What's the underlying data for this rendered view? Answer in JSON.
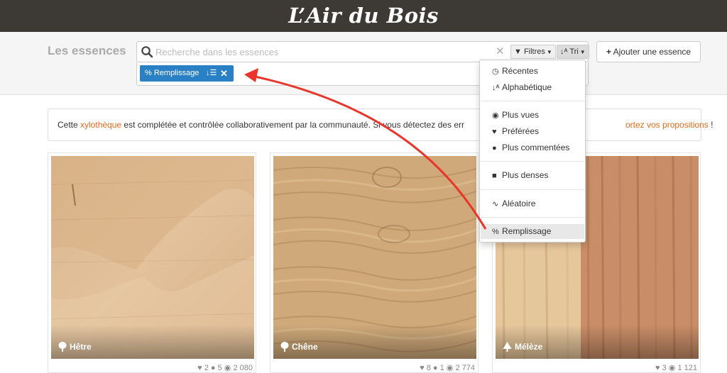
{
  "app": {
    "brand": "L’Air du Bois"
  },
  "toolbar": {
    "section_title": "Les essences",
    "search_placeholder": "Recherche dans les essences",
    "search_value": "",
    "filters_label": "Filtres",
    "sort_label": "Tri",
    "add_label": "Ajouter une essence"
  },
  "active_filter": {
    "label": "Remplissage",
    "sort_icon_text": "↓☰"
  },
  "info": {
    "before": "Cette ",
    "link": "xylothèque",
    "after": " est complétée et contrôlée collaborativement par la communauté. Si vous détectez des err",
    "right_link": "ortez vos propositions",
    "right_end": " !"
  },
  "sort_menu": {
    "items": [
      {
        "label": "Récentes",
        "icon": "clock-icon"
      },
      {
        "label": "Alphabétique",
        "icon": "alpha-sort-icon"
      },
      {
        "label": "Plus vues",
        "icon": "eye-icon"
      },
      {
        "label": "Préférées",
        "icon": "heart-icon"
      },
      {
        "label": "Plus commentées",
        "icon": "comment-icon"
      },
      {
        "label": "Plus denses",
        "icon": "weight-icon"
      },
      {
        "label": "Aléatoire",
        "icon": "random-icon"
      },
      {
        "label": "Remplissage",
        "icon": "percent-icon",
        "active": true
      }
    ]
  },
  "cards": [
    {
      "name": "Hêtre",
      "likes": "2",
      "comments": "5",
      "views": "2 080",
      "tree_icon": "deciduous-tree-icon"
    },
    {
      "name": "Chêne",
      "likes": "8",
      "comments": "1",
      "views": "2 774",
      "tree_icon": "deciduous-tree-icon"
    },
    {
      "name": "Mélèze",
      "likes": "3",
      "comments": "",
      "views": "1 121",
      "tree_icon": "conifer-tree-icon"
    }
  ],
  "colors": {
    "topbar": "#3d3a36",
    "accent_blue": "#2a80c4",
    "link_orange": "#e26a1c",
    "annotation_arrow": "#e8372a"
  }
}
